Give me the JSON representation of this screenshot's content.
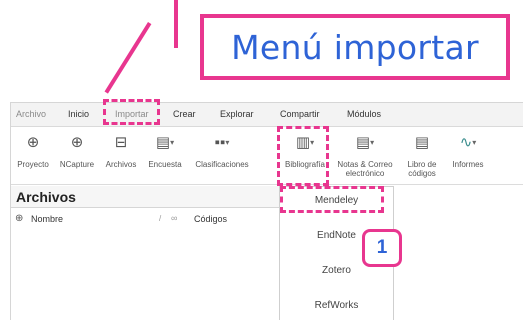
{
  "callout": {
    "text": "Menú importar"
  },
  "menu": {
    "items": [
      {
        "label": "Archivo",
        "name": "menu-archivo"
      },
      {
        "label": "Inicio",
        "name": "menu-inicio"
      },
      {
        "label": "Importar",
        "name": "menu-importar"
      },
      {
        "label": "Crear",
        "name": "menu-crear"
      },
      {
        "label": "Explorar",
        "name": "menu-explorar"
      },
      {
        "label": "Compartir",
        "name": "menu-compartir"
      },
      {
        "label": "Módulos",
        "name": "menu-modulos"
      }
    ]
  },
  "ribbon": {
    "buttons": [
      {
        "label": "Proyecto",
        "icon": "project-icon",
        "glyph": "⊕",
        "caret": false
      },
      {
        "label": "NCapture",
        "icon": "ncapture-globe-icon",
        "glyph": "⊕",
        "caret": false
      },
      {
        "label": "Archivos",
        "icon": "files-icon",
        "glyph": "⊟",
        "caret": false
      },
      {
        "label": "Encuesta",
        "icon": "survey-icon",
        "glyph": "▤",
        "caret": true
      },
      {
        "label": "Clasificaciones",
        "icon": "classifications-icon",
        "glyph": "▪▪",
        "caret": true
      },
      {
        "label": "Bibliografía",
        "icon": "bibliography-icon",
        "glyph": "▥",
        "caret": true
      },
      {
        "label": "Notas & Correo electrónico",
        "icon": "notes-email-icon",
        "glyph": "▤",
        "caret": true
      },
      {
        "label": "Libro de códigos",
        "icon": "codebook-icon",
        "glyph": "▤",
        "caret": false
      },
      {
        "label": "Informes",
        "icon": "reports-icon",
        "glyph": "∿",
        "caret": true
      }
    ]
  },
  "pane": {
    "title": "Archivos",
    "columns": {
      "name": "Nombre",
      "codes": "Códigos"
    }
  },
  "dropdown": {
    "items": [
      {
        "label": "Mendeley",
        "name": "dropdown-item-mendeley"
      },
      {
        "label": "EndNote",
        "name": "dropdown-item-endnote"
      },
      {
        "label": "Zotero",
        "name": "dropdown-item-zotero"
      },
      {
        "label": "RefWorks",
        "name": "dropdown-item-refworks"
      }
    ]
  },
  "badge": {
    "text": "1"
  },
  "colors": {
    "highlight": "#e8368f",
    "callout_text": "#2e63d6"
  }
}
